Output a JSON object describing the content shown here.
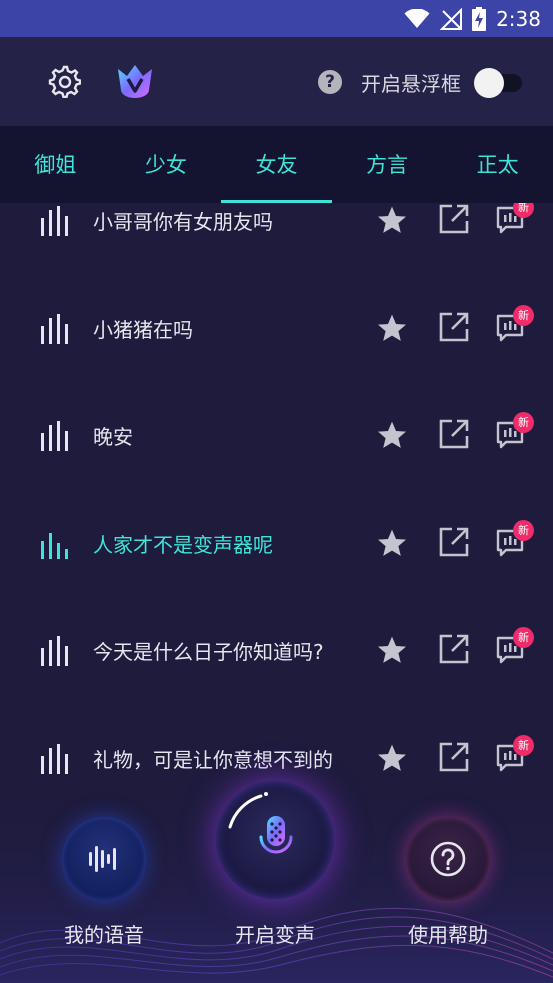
{
  "status_bar": {
    "time": "2:38"
  },
  "header": {
    "float_window_label": "开启悬浮框",
    "float_window_enabled": false,
    "help_symbol": "?"
  },
  "tabs": [
    {
      "label": "御姐",
      "active": false
    },
    {
      "label": "少女",
      "active": false
    },
    {
      "label": "女友",
      "active": true
    },
    {
      "label": "方言",
      "active": false
    },
    {
      "label": "正太",
      "active": false
    }
  ],
  "voice_list": [
    {
      "text": "小哥哥你有女朋友吗",
      "new_badge": "新",
      "playing": false
    },
    {
      "text": "小猪猪在吗",
      "new_badge": "新",
      "playing": false
    },
    {
      "text": "晚安",
      "new_badge": "新",
      "playing": false
    },
    {
      "text": "人家才不是变声器呢",
      "new_badge": "新",
      "playing": true
    },
    {
      "text": "今天是什么日子你知道吗?",
      "new_badge": "新",
      "playing": false
    },
    {
      "text": "礼物，可是让你意想不到的",
      "new_badge": "新",
      "playing": false
    }
  ],
  "bottom_bar": {
    "my_voice_label": "我的语音",
    "start_changer_label": "开启变声",
    "help_label": "使用帮助"
  },
  "colors": {
    "accent": "#3fe4d8",
    "badge": "#ef2b6a",
    "background": "#1e1b3d",
    "status_bar": "#3d44a8"
  }
}
